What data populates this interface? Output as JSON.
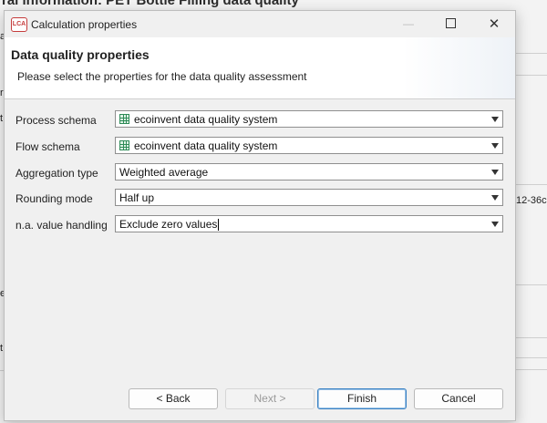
{
  "background": {
    "title": "ral information: PET Bottle Filling data quality",
    "right_fragment": "12-36c",
    "left_fragments": [
      "a",
      "r",
      "t",
      "e",
      "t"
    ]
  },
  "dialog": {
    "window_title": "Calculation properties",
    "app_icon_text": "LCA",
    "header_title": "Data quality properties",
    "header_description": "Please select the properties for the data quality assessment",
    "fields": [
      {
        "label": "Process schema",
        "value": "ecoinvent data quality system",
        "icon": "grid-table-icon"
      },
      {
        "label": "Flow schema",
        "value": "ecoinvent data quality system",
        "icon": "grid-table-icon"
      },
      {
        "label": "Aggregation type",
        "value": "Weighted average",
        "icon": ""
      },
      {
        "label": "Rounding mode",
        "value": "Half up",
        "icon": ""
      },
      {
        "label": "n.a. value handling",
        "value": "Exclude zero values",
        "icon": ""
      }
    ],
    "buttons": {
      "back": "< Back",
      "next": "Next >",
      "finish": "Finish",
      "cancel": "Cancel"
    }
  }
}
